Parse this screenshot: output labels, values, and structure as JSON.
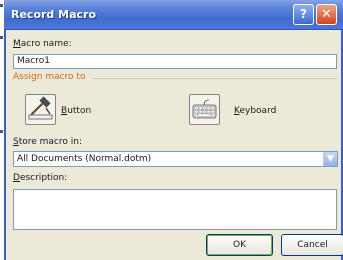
{
  "dialog": {
    "title": "Record Macro",
    "help_icon": "question-mark-icon",
    "close_icon": "close-x-icon"
  },
  "macro_name": {
    "label_key": "M",
    "label_rest": "acro name:",
    "value": "Macro1"
  },
  "assign_group": {
    "label": "Assign macro to",
    "color": "#cc6a1d"
  },
  "button_option": {
    "icon": "button-hammer-icon",
    "label_key": "B",
    "label_rest": "utton"
  },
  "keyboard_option": {
    "icon": "keyboard-icon",
    "label_key": "K",
    "label_rest": "eyboard"
  },
  "store_in": {
    "label_key": "S",
    "label_rest": "tore macro in:",
    "selected": "All Documents (Normal.dotm)",
    "dropdown_icon": "chevron-down-icon"
  },
  "description": {
    "label_key": "D",
    "label_rest": "escription:",
    "value": ""
  },
  "actions": {
    "ok_label": "OK",
    "cancel_label": "Cancel"
  }
}
